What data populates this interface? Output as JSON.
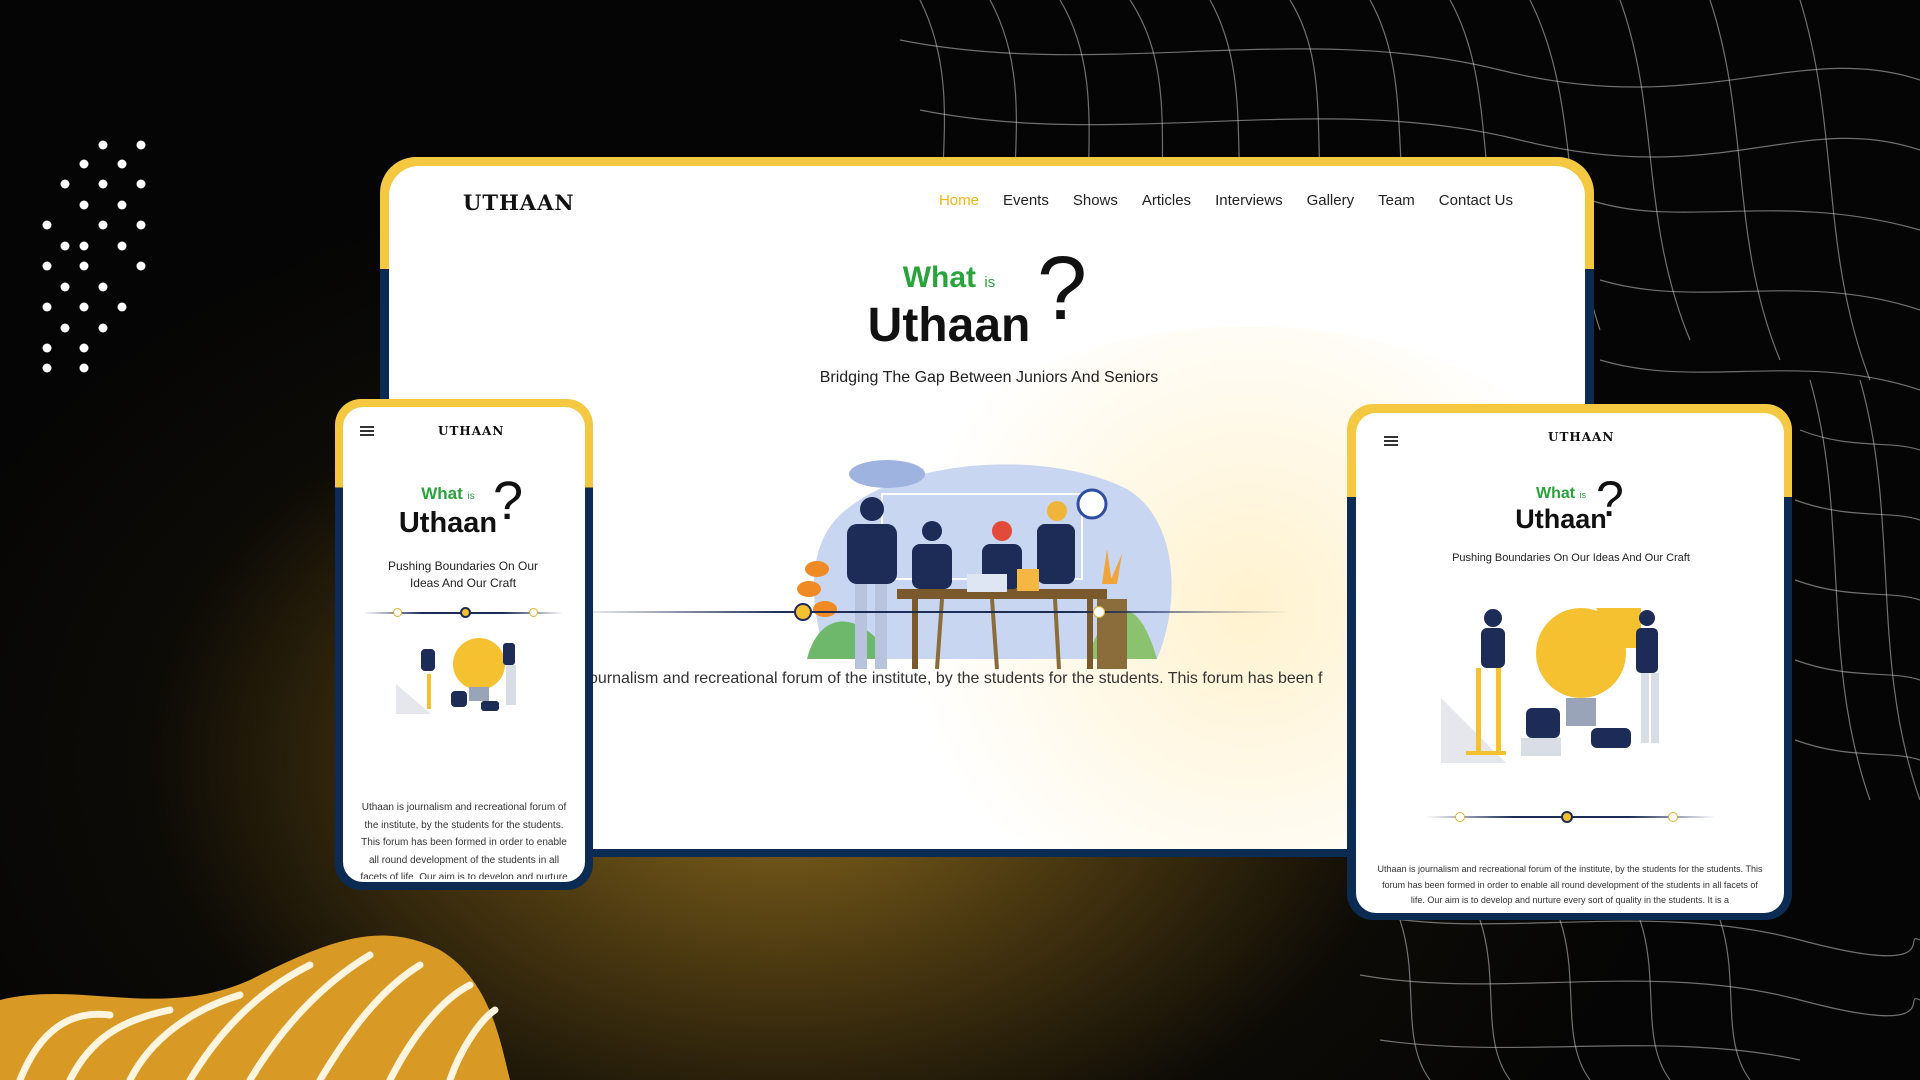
{
  "site": {
    "logo_text": "UTHAAN",
    "nav": [
      "Home",
      "Events",
      "Shows",
      "Articles",
      "Interviews",
      "Gallery",
      "Team",
      "Contact Us"
    ],
    "active_nav": "Home"
  },
  "desktop": {
    "what": "What",
    "is": "is",
    "title": "Uthaan",
    "qmark": "?",
    "tagline": "Bridging The Gap Between Juniors And Seniors",
    "body": "ournalism and recreational forum of the institute, by the students for the students. This forum has been f"
  },
  "phone": {
    "what": "What",
    "is": "is",
    "title": "Uthaan",
    "qmark": "?",
    "tagline": "Pushing Boundaries On Our Ideas And Our Craft",
    "body": "Uthaan is journalism and recreational forum of the institute, by the students for the students. This forum has been formed in order to enable all round development of the students in all facets of life. Our aim is to develop and nurture"
  },
  "tablet": {
    "what": "What",
    "is": "is",
    "title": "Uthaan",
    "qmark": "?",
    "tagline": "Pushing Boundaries On Our Ideas And Our Craft",
    "body": "Uthaan is journalism and recreational forum of the institute, by the students for the students. This forum has been formed in order to enable all round development of the students in all facets of life. Our aim is to develop and nurture every sort of quality in the students. It is a"
  },
  "colors": {
    "accent_yellow": "#f5c842",
    "navy": "#0c2b52",
    "green": "#2aa33c",
    "active_nav": "#f2b515"
  }
}
